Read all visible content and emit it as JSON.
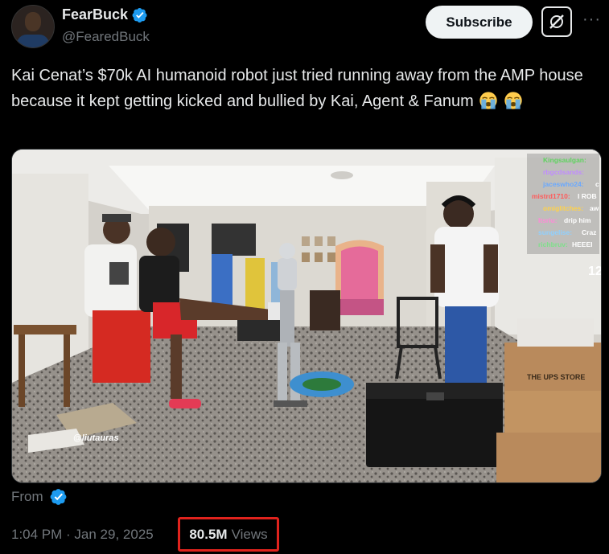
{
  "author": {
    "display_name": "FearBuck",
    "handle": "@FearedBuck",
    "avatar_icon": "avatar-player-photo",
    "verified_icon": "verified-badge-icon"
  },
  "actions": {
    "subscribe_label": "Subscribe",
    "grok_icon": "grok-icon",
    "more_icon": "more-icon"
  },
  "tweet": {
    "text": "Kai Cenat’s $70k AI humanoid robot just tried running away from the AMP house because it kept getting kicked and bullied by Kai, Agent & Fanum",
    "emojis": [
      "loudly-crying-face",
      "loudly-crying-face"
    ]
  },
  "media": {
    "watermark": "@liutauras",
    "chat": [
      {
        "user": "Kingsaulgan:",
        "msg": "",
        "color": "#5fd35f"
      },
      {
        "user": "rbgcdsands:",
        "msg": "",
        "color": "#c08bff"
      },
      {
        "user": "jaceswho24:",
        "msg": "c",
        "color": "#6aa9ff"
      },
      {
        "user": "mistrd1710:",
        "msg": "I ROB",
        "color": "#ff5a5a"
      },
      {
        "user": "omiglitches:",
        "msg": "aw",
        "color": "#ffd24a"
      },
      {
        "user": "Itsriu:",
        "msg": "drip him",
        "color": "#ff8ad8"
      },
      {
        "user": "sungelise:",
        "msg": "Craz",
        "color": "#8fd0ff"
      },
      {
        "user": "richbruv:",
        "msg": "HEEEI",
        "color": "#7ee08a"
      }
    ],
    "stream_number": "12",
    "sign_text": "THE UPS STORE"
  },
  "footer": {
    "from_label": "From",
    "timestamp": "1:04 PM · Jan 29, 2025",
    "views_count": "80.5M",
    "views_label": "Views",
    "highlight_color": "#e0231d"
  },
  "colors": {
    "background": "#000000",
    "text": "#e7e9ea",
    "muted": "#71767b",
    "verified": "#1d9bf0"
  }
}
